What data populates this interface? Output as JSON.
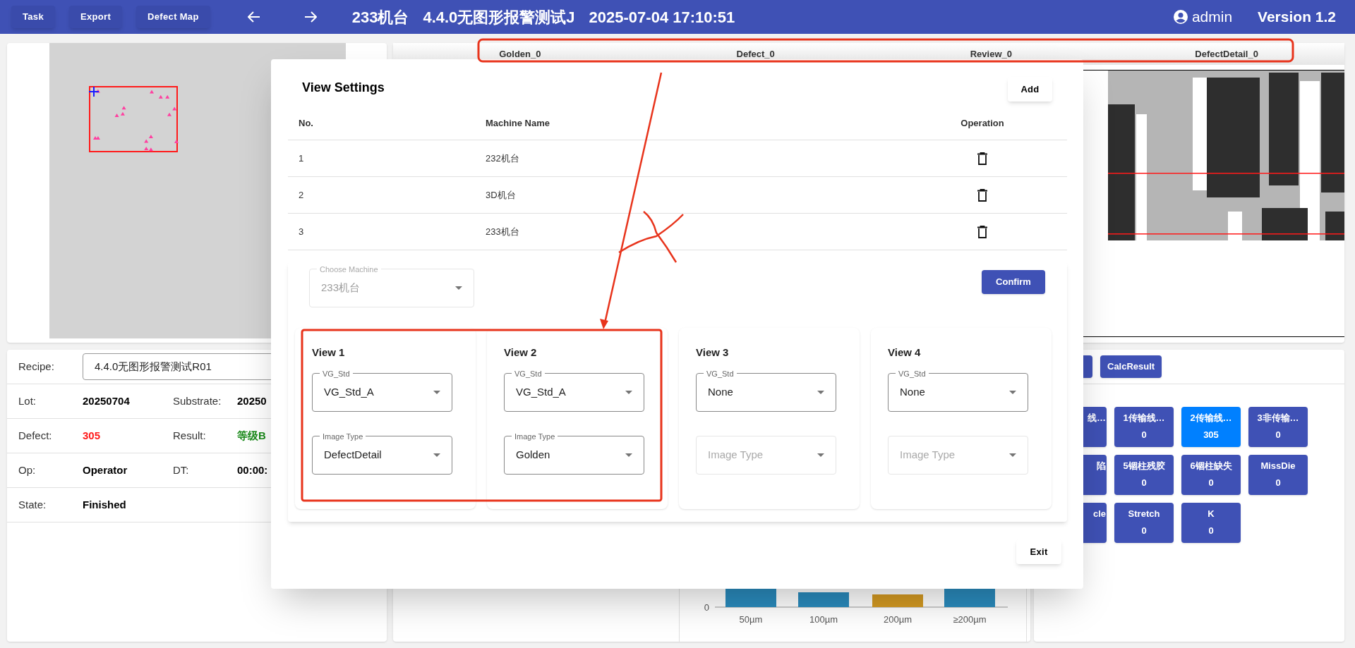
{
  "toolbar": {
    "buttons": [
      "Task",
      "Export",
      "Defect Map"
    ]
  },
  "header": {
    "machine": "233机台",
    "recipe": "4.4.0无图形报警测试J",
    "datetime": "2025-07-04 17:10:51",
    "user": "admin",
    "version": "Version 1.2"
  },
  "info": {
    "recipe_label": "Recipe:",
    "recipe_value": "4.4.0无图形报警测试R01",
    "rows": [
      [
        {
          "label": "Lot:",
          "value": "20250704",
          "kind": "plain"
        },
        {
          "label": "Substrate:",
          "value": "20250",
          "kind": "plain"
        }
      ],
      [
        {
          "label": "Defect:",
          "value": "305",
          "kind": "alert"
        },
        {
          "label": "Result:",
          "value": "等级B",
          "kind": "good"
        }
      ],
      [
        {
          "label": "Op:",
          "value": "Operator",
          "kind": "plain"
        },
        {
          "label": "DT:",
          "value": "00:00:",
          "kind": "plain"
        }
      ],
      [
        {
          "label": "State:",
          "value": "Finished",
          "kind": "plain"
        }
      ]
    ]
  },
  "image_panel": {
    "views": [
      "Golden_0",
      "Defect_0",
      "Review_0",
      "DefectDetail_0"
    ]
  },
  "size_chart": {
    "y_tick": "0",
    "categories": [
      {
        "label": "50µm",
        "highlighted": false
      },
      {
        "label": "100µm",
        "highlighted": false
      },
      {
        "label": "200µm",
        "highlighted": true
      },
      {
        "label": "≥200µm",
        "highlighted": false
      }
    ]
  },
  "actions": {
    "buttons": [
      "CalcResult"
    ]
  },
  "defect_types": [
    {
      "kind": "partial",
      "label": "线…"
    },
    {
      "kind": "full",
      "label": "1传输线…",
      "count": "0",
      "selected": false
    },
    {
      "kind": "full",
      "label": "2传输线…",
      "count": "305",
      "selected": true
    },
    {
      "kind": "full",
      "label": "3非传输…",
      "count": "0",
      "selected": false
    },
    {
      "kind": "partial",
      "label": "陷"
    },
    {
      "kind": "full",
      "label": "5锢柱残胶",
      "count": "0",
      "selected": false
    },
    {
      "kind": "full",
      "label": "6锢柱缺失",
      "count": "0",
      "selected": false
    },
    {
      "kind": "full",
      "label": "MissDie",
      "count": "0",
      "selected": false
    },
    {
      "kind": "partial",
      "label": "cle"
    },
    {
      "kind": "full",
      "label": "Stretch",
      "count": "0",
      "selected": false
    },
    {
      "kind": "full",
      "label": "K",
      "count": "0",
      "selected": false
    }
  ],
  "dialog": {
    "title": "View Settings",
    "add": "Add",
    "columns": [
      "No.",
      "Machine Name",
      "Operation"
    ],
    "rows": [
      {
        "no": "1",
        "machine": "232机台"
      },
      {
        "no": "2",
        "machine": "3D机台"
      },
      {
        "no": "3",
        "machine": "233机台"
      }
    ],
    "machine_select": {
      "label": "Choose Machine",
      "value": "233机台",
      "disabled": true
    },
    "confirm": "Confirm",
    "views": [
      {
        "title": "View 1",
        "std": {
          "label": "VG_Std",
          "value": "VG_Std_A",
          "disabled": false
        },
        "image_type": {
          "label": "Image Type",
          "value": "DefectDetail",
          "disabled": false
        }
      },
      {
        "title": "View 2",
        "std": {
          "label": "VG_Std",
          "value": "VG_Std_A",
          "disabled": false
        },
        "image_type": {
          "label": "Image Type",
          "value": "Golden",
          "disabled": false
        }
      },
      {
        "title": "View 3",
        "std": {
          "label": "VG_Std",
          "value": "None",
          "disabled": false
        },
        "image_type": {
          "placeholder": "Image Type",
          "disabled": true
        }
      },
      {
        "title": "View 4",
        "std": {
          "label": "VG_Std",
          "value": "None",
          "disabled": false
        },
        "image_type": {
          "placeholder": "Image Type",
          "disabled": true
        }
      }
    ],
    "exit": "Exit"
  }
}
